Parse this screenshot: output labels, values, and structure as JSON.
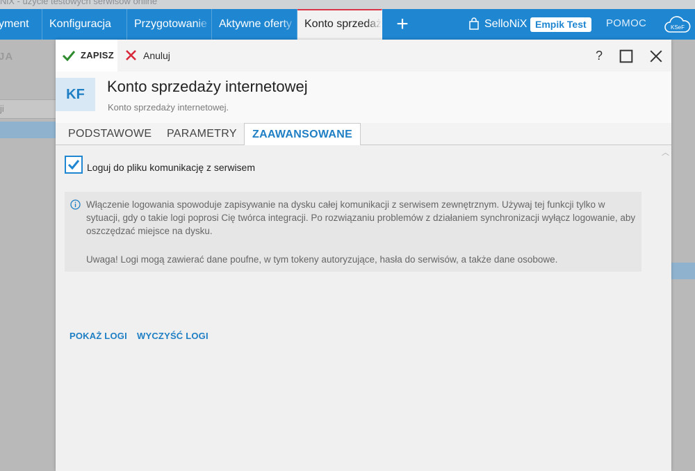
{
  "window": {
    "title": "NiX - użycie testowych serwisów online"
  },
  "topbar": {
    "tabs": [
      {
        "label": "yment"
      },
      {
        "label": "Konfiguracja"
      },
      {
        "label": "Przygotowanie"
      },
      {
        "label": "Aktywne oferty"
      },
      {
        "label": "Konto sprzedaży"
      }
    ],
    "add_icon": "plus-icon",
    "store_name": "SelloNiX",
    "store_badge": "Empik Test",
    "help_label": "POMOC",
    "cloud_icon": "cloud-icon",
    "cloud_text": "KSeF"
  },
  "background": {
    "left_label": "JA",
    "left_field": "ji"
  },
  "dialog": {
    "toolbar": {
      "save_label": "ZAPISZ",
      "cancel_label": "Anuluj",
      "help_icon": "?"
    },
    "header": {
      "avatar": "KF",
      "title": "Konto sprzedaży internetowej",
      "subtitle": "Konto sprzedaży internetowej."
    },
    "tabs": [
      {
        "label": "PODSTAWOWE"
      },
      {
        "label": "PARAMETRY"
      },
      {
        "label": "ZAAWANSOWANE"
      }
    ],
    "active_tab": "ZAAWANSOWANE",
    "content": {
      "log_checkbox": {
        "label": "Loguj do pliku komunikację z serwisem",
        "checked": true
      },
      "info_text": "Włączenie logowania spowoduje zapisywanie na dysku całej komunikacji z serwisem zewnętrznym. Używaj tej funkcji tylko w sytuacji, gdy o takie logi poprosi Cię twórca integracji. Po rozwiązaniu problemów z działaniem synchronizacji wyłącz logowanie, aby oszczędzać miejsce na dysku.",
      "warning_text": "Uwaga! Logi mogą zawierać dane poufne, w tym tokeny autoryzujące, hasła do serwisów, a także dane osobowe.",
      "show_logs": "POKAŻ LOGI",
      "clear_logs": "WYCZYŚĆ LOGI"
    }
  },
  "colors": {
    "accent": "#1f86d1",
    "link": "#1f7fc4",
    "active_tab_marker": "#d9364a",
    "save_green": "#2e8b2e",
    "cancel_red": "#d8283a"
  }
}
